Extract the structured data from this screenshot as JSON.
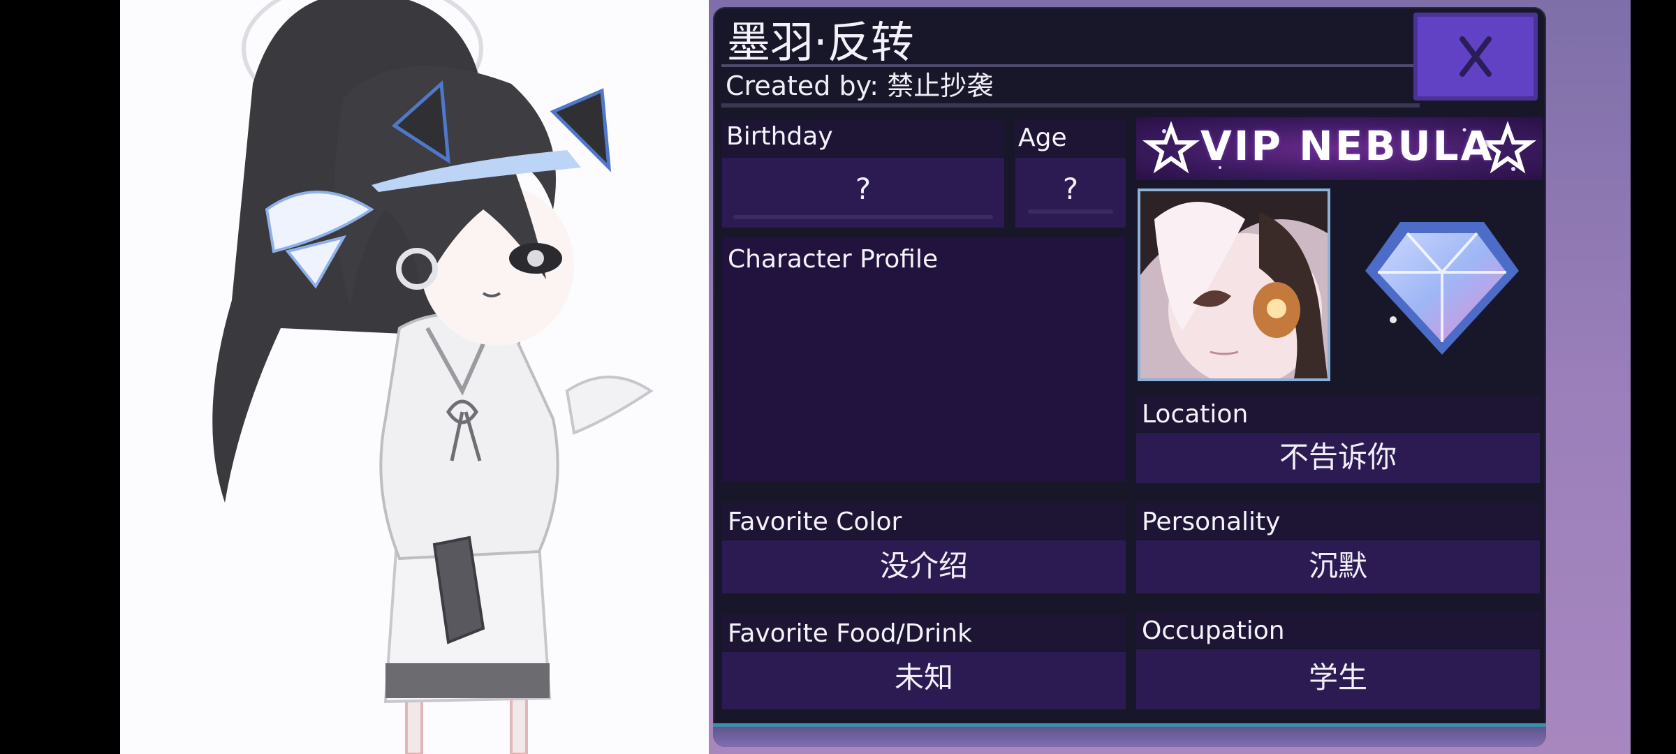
{
  "profile": {
    "character_name": "墨羽·反转",
    "created_by": "Created by: 禁止抄袭"
  },
  "close_button": {
    "label": "X"
  },
  "fields": {
    "birthday": {
      "label": "Birthday",
      "value": "?"
    },
    "age": {
      "label": "Age",
      "value": "?"
    },
    "character_profile": {
      "label": "Character Profile",
      "value": ""
    },
    "location": {
      "label": "Location",
      "value": "不告诉你"
    },
    "favorite_color": {
      "label": "Favorite Color",
      "value": "没介绍"
    },
    "personality": {
      "label": "Personality",
      "value": "沉默"
    },
    "favorite_food": {
      "label": "Favorite Food/Drink",
      "value": "未知"
    },
    "occupation": {
      "label": "Occupation",
      "value": "学生"
    }
  },
  "vip_badge": {
    "text": "VIP NEBULA"
  },
  "icons": {
    "close": "close-icon",
    "gem": "nebula-gem-icon",
    "star": "star-icon"
  },
  "colors": {
    "card_bg": "#18172a",
    "value_box": "#2c1a52",
    "close_button": "#6242c4",
    "backdrop": "#9a7fba"
  }
}
